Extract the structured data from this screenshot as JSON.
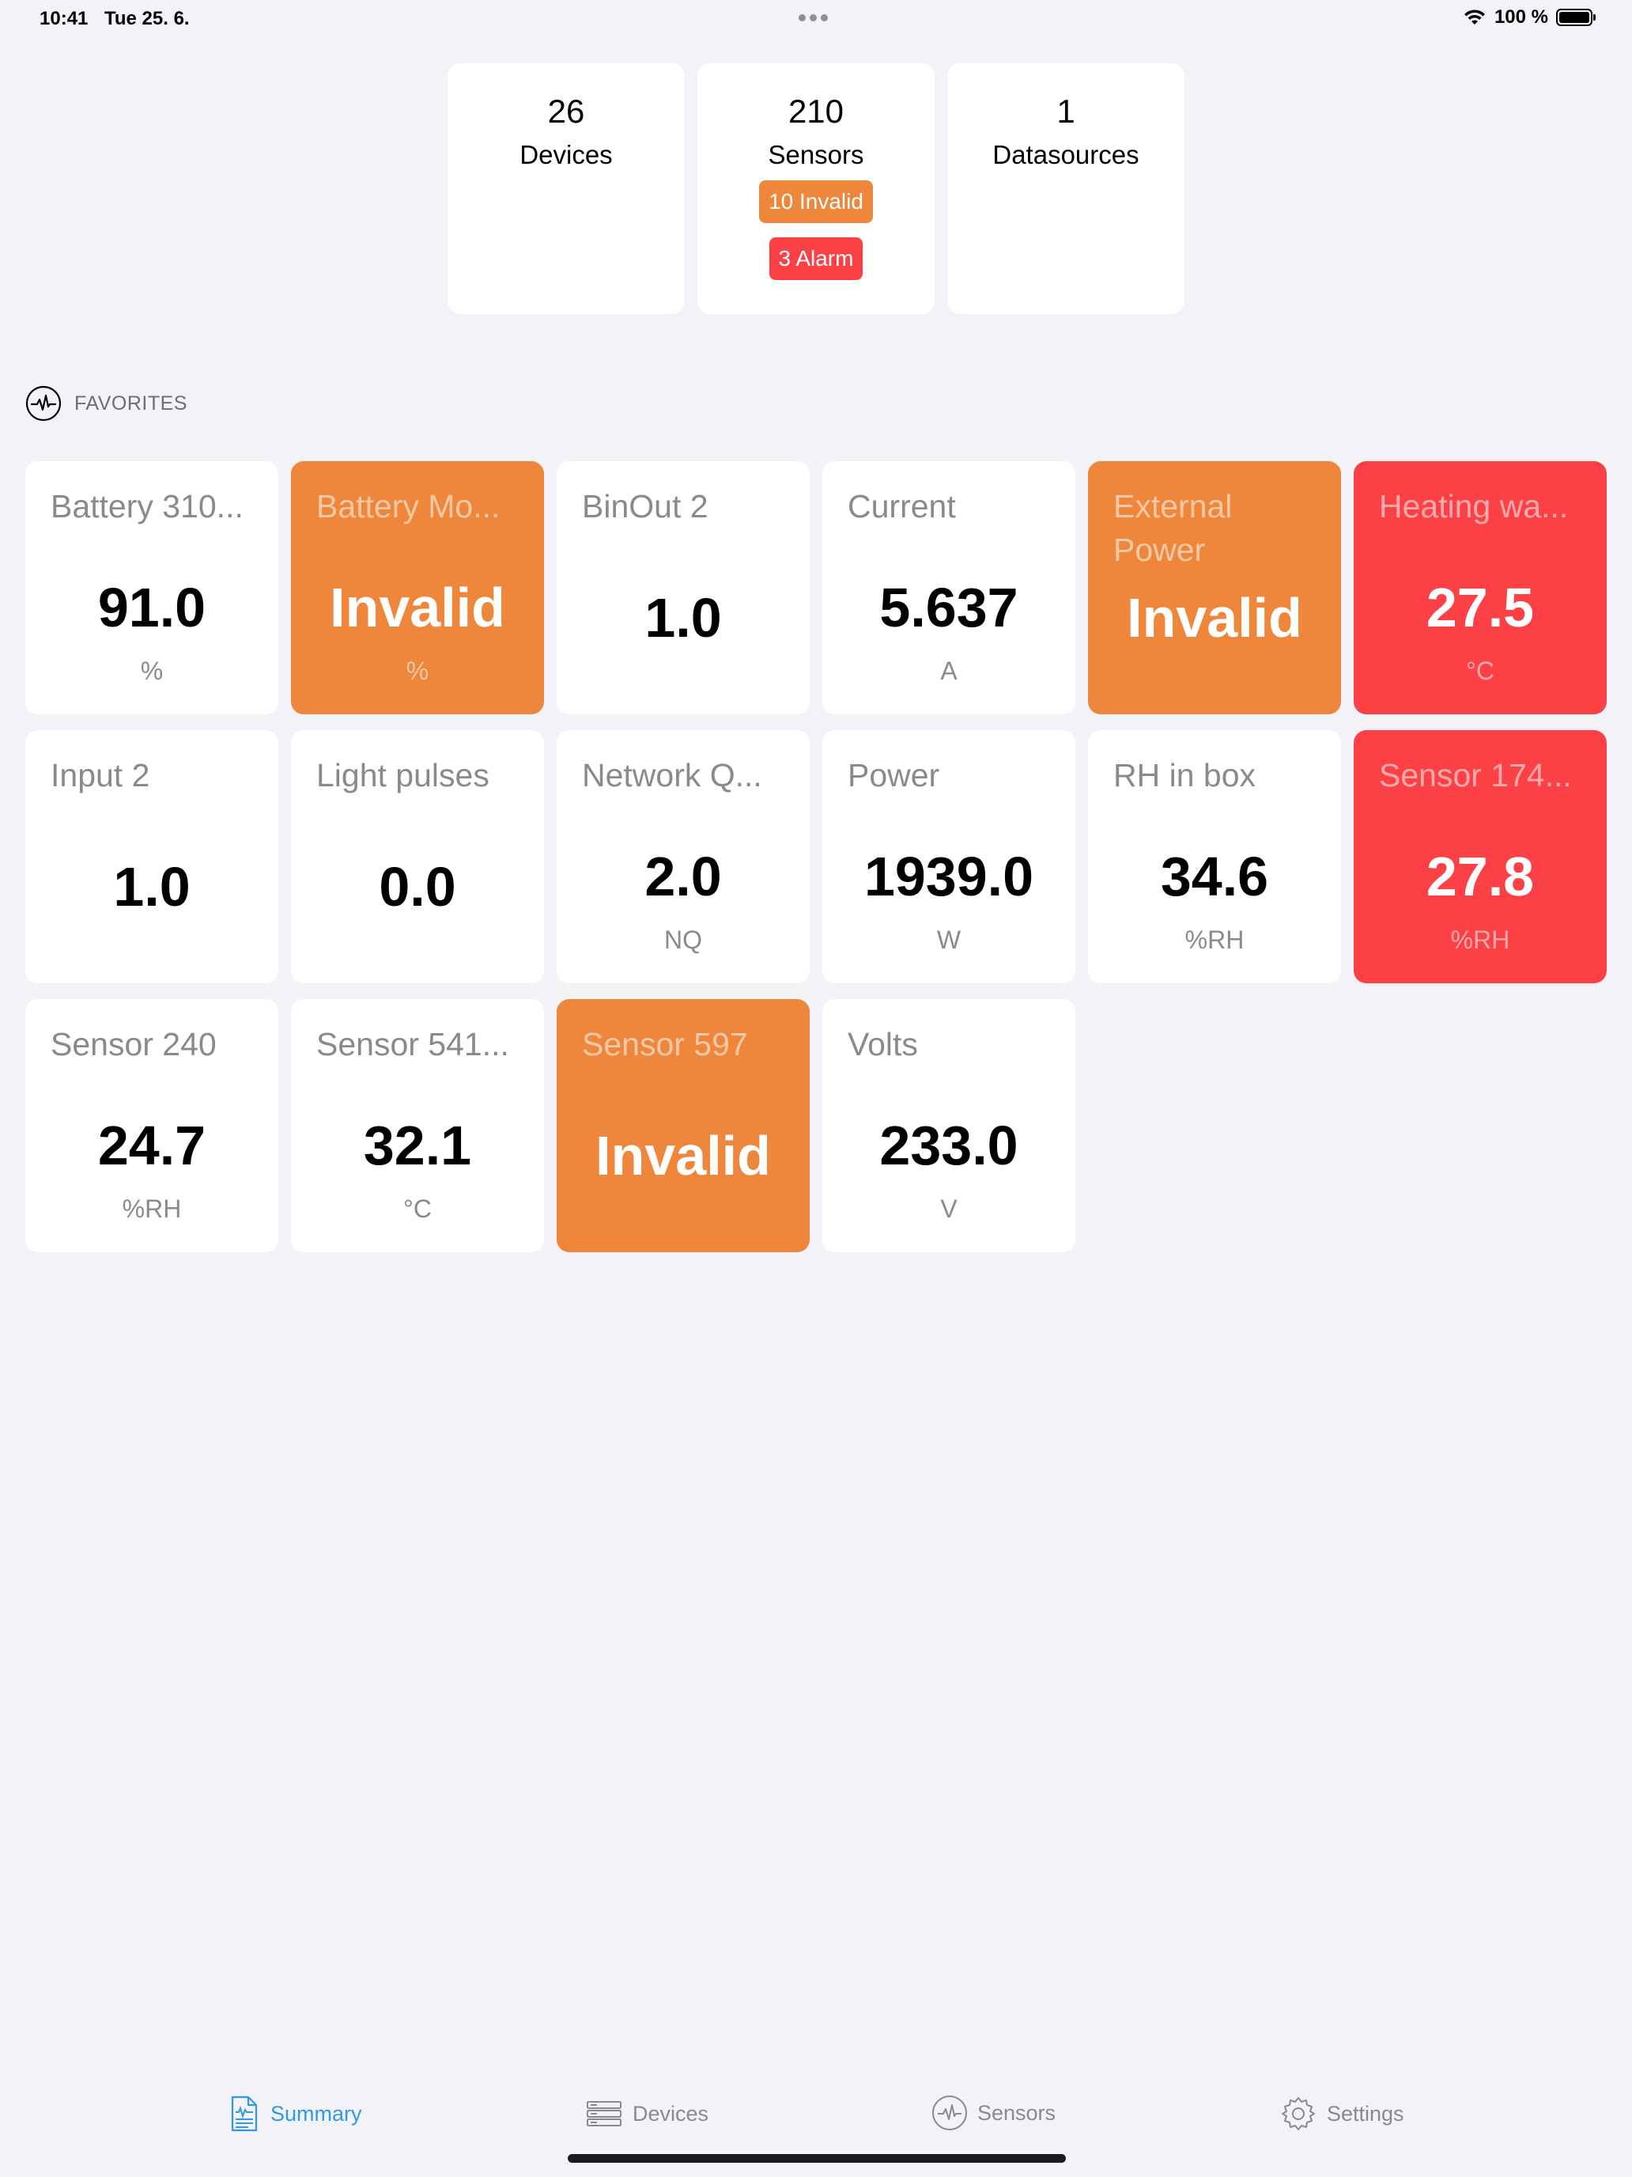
{
  "status_bar": {
    "time": "10:41",
    "date": "Tue 25. 6.",
    "battery": "100 %"
  },
  "summary": {
    "devices": {
      "count": "26",
      "label": "Devices"
    },
    "sensors": {
      "count": "210",
      "label": "Sensors",
      "invalid_badge": "10 Invalid",
      "alarm_badge": "3 Alarm"
    },
    "datasources": {
      "count": "1",
      "label": "Datasources"
    }
  },
  "favorites": {
    "title": "FAVORITES",
    "tiles": [
      {
        "name": "Battery 310...",
        "value": "91.0",
        "unit": "%",
        "state": "normal"
      },
      {
        "name": "Battery Mo...",
        "value": "Invalid",
        "unit": "%",
        "state": "invalid"
      },
      {
        "name": "BinOut 2",
        "value": "1.0",
        "unit": "",
        "state": "normal"
      },
      {
        "name": "Current",
        "value": "5.637",
        "unit": "A",
        "state": "normal"
      },
      {
        "name": "External Power",
        "value": "Invalid",
        "unit": "",
        "state": "invalid"
      },
      {
        "name": "Heating wa...",
        "value": "27.5",
        "unit": "°C",
        "state": "alarm"
      },
      {
        "name": "Input 2",
        "value": "1.0",
        "unit": "",
        "state": "normal"
      },
      {
        "name": "Light pulses",
        "value": "0.0",
        "unit": "",
        "state": "normal"
      },
      {
        "name": "Network Q...",
        "value": "2.0",
        "unit": "NQ",
        "state": "normal"
      },
      {
        "name": "Power",
        "value": "1939.0",
        "unit": "W",
        "state": "normal"
      },
      {
        "name": "RH in box",
        "value": "34.6",
        "unit": "%RH",
        "state": "normal"
      },
      {
        "name": "Sensor 174...",
        "value": "27.8",
        "unit": "%RH",
        "state": "alarm"
      },
      {
        "name": "Sensor 240",
        "value": "24.7",
        "unit": "%RH",
        "state": "normal"
      },
      {
        "name": "Sensor 541...",
        "value": "32.1",
        "unit": "°C",
        "state": "normal"
      },
      {
        "name": "Sensor 597",
        "value": "Invalid",
        "unit": "",
        "state": "invalid"
      },
      {
        "name": "Volts",
        "value": "233.0",
        "unit": "V",
        "state": "normal"
      }
    ]
  },
  "tab_bar": {
    "summary": "Summary",
    "devices": "Devices",
    "sensors": "Sensors",
    "settings": "Settings"
  },
  "colors": {
    "invalid": "#ee863b",
    "alarm": "#fc4146",
    "accent": "#2e9ae6",
    "background": "#f2f2f7"
  }
}
